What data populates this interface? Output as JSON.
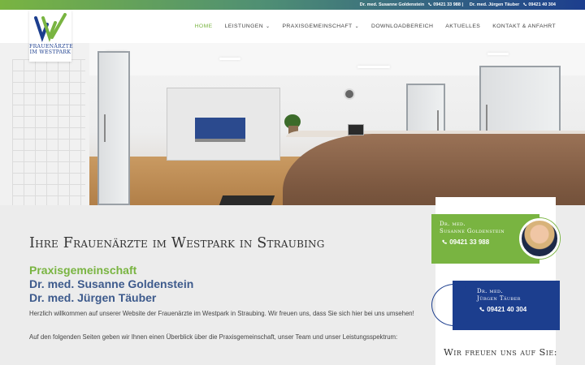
{
  "topbar": {
    "contact1": {
      "name": "Dr. med. Susanne Goldenstein",
      "phone": "09421 33 988"
    },
    "contact2": {
      "name": "Dr. med. Jürgen Täuber",
      "phone": "09421 40 304"
    },
    "separator": "|"
  },
  "logo": {
    "line1": "FRAUENÄRZTE",
    "line2": "IM WESTPARK",
    "icon": "w-logo-icon"
  },
  "nav": {
    "home": "HOME",
    "leistungen": "LEISTUNGEN",
    "praxis": "PRAXISGEMEINSCHAFT",
    "download": "DOWNLOADBEREICH",
    "aktuelles": "AKTUELLES",
    "kontakt": "KONTAKT & ANFAHRT"
  },
  "main": {
    "headline": "Ihre Frauenärzte im Westpark in Straubing",
    "sub1": "Praxisgemeinschaft",
    "sub2": "Dr. med. Susanne Goldenstein",
    "sub3": "Dr. med. Jürgen Täuber",
    "p1": "Herzlich willkommen auf unserer Website der Frauenärzte im Westpark in Straubing. Wir freuen uns, dass Sie sich hier bei uns umsehen!",
    "p2": "Auf den folgenden Seiten geben wir Ihnen einen Überblick über die Praxisgemeinschaft, unser Team und unser Leistungsspektrum:"
  },
  "sidebar": {
    "card1": {
      "role": "Dr. med.",
      "name": "Susanne Goldenstein",
      "phone": "09421 33 988"
    },
    "card2": {
      "role": "Dr. med.",
      "name": "Jürgen Täuber",
      "phone": "09421 40 304"
    },
    "welcome": "Wir freuen uns auf Sie:"
  },
  "colors": {
    "green": "#79b441",
    "blue": "#1c3e8e",
    "gray_blue": "#3d5a8c"
  }
}
